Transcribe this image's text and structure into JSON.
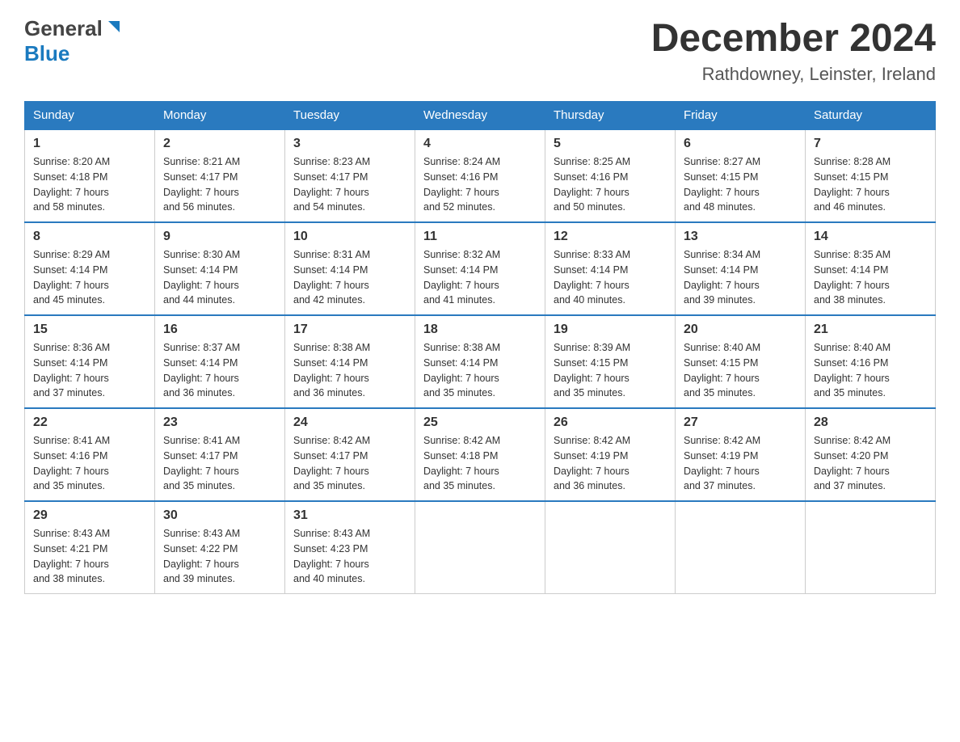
{
  "header": {
    "logo_general": "General",
    "logo_blue": "Blue",
    "title": "December 2024",
    "location": "Rathdowney, Leinster, Ireland"
  },
  "calendar": {
    "days_of_week": [
      "Sunday",
      "Monday",
      "Tuesday",
      "Wednesday",
      "Thursday",
      "Friday",
      "Saturday"
    ],
    "weeks": [
      [
        {
          "day": "1",
          "sunrise": "Sunrise: 8:20 AM",
          "sunset": "Sunset: 4:18 PM",
          "daylight": "Daylight: 7 hours",
          "minutes": "and 58 minutes."
        },
        {
          "day": "2",
          "sunrise": "Sunrise: 8:21 AM",
          "sunset": "Sunset: 4:17 PM",
          "daylight": "Daylight: 7 hours",
          "minutes": "and 56 minutes."
        },
        {
          "day": "3",
          "sunrise": "Sunrise: 8:23 AM",
          "sunset": "Sunset: 4:17 PM",
          "daylight": "Daylight: 7 hours",
          "minutes": "and 54 minutes."
        },
        {
          "day": "4",
          "sunrise": "Sunrise: 8:24 AM",
          "sunset": "Sunset: 4:16 PM",
          "daylight": "Daylight: 7 hours",
          "minutes": "and 52 minutes."
        },
        {
          "day": "5",
          "sunrise": "Sunrise: 8:25 AM",
          "sunset": "Sunset: 4:16 PM",
          "daylight": "Daylight: 7 hours",
          "minutes": "and 50 minutes."
        },
        {
          "day": "6",
          "sunrise": "Sunrise: 8:27 AM",
          "sunset": "Sunset: 4:15 PM",
          "daylight": "Daylight: 7 hours",
          "minutes": "and 48 minutes."
        },
        {
          "day": "7",
          "sunrise": "Sunrise: 8:28 AM",
          "sunset": "Sunset: 4:15 PM",
          "daylight": "Daylight: 7 hours",
          "minutes": "and 46 minutes."
        }
      ],
      [
        {
          "day": "8",
          "sunrise": "Sunrise: 8:29 AM",
          "sunset": "Sunset: 4:14 PM",
          "daylight": "Daylight: 7 hours",
          "minutes": "and 45 minutes."
        },
        {
          "day": "9",
          "sunrise": "Sunrise: 8:30 AM",
          "sunset": "Sunset: 4:14 PM",
          "daylight": "Daylight: 7 hours",
          "minutes": "and 44 minutes."
        },
        {
          "day": "10",
          "sunrise": "Sunrise: 8:31 AM",
          "sunset": "Sunset: 4:14 PM",
          "daylight": "Daylight: 7 hours",
          "minutes": "and 42 minutes."
        },
        {
          "day": "11",
          "sunrise": "Sunrise: 8:32 AM",
          "sunset": "Sunset: 4:14 PM",
          "daylight": "Daylight: 7 hours",
          "minutes": "and 41 minutes."
        },
        {
          "day": "12",
          "sunrise": "Sunrise: 8:33 AM",
          "sunset": "Sunset: 4:14 PM",
          "daylight": "Daylight: 7 hours",
          "minutes": "and 40 minutes."
        },
        {
          "day": "13",
          "sunrise": "Sunrise: 8:34 AM",
          "sunset": "Sunset: 4:14 PM",
          "daylight": "Daylight: 7 hours",
          "minutes": "and 39 minutes."
        },
        {
          "day": "14",
          "sunrise": "Sunrise: 8:35 AM",
          "sunset": "Sunset: 4:14 PM",
          "daylight": "Daylight: 7 hours",
          "minutes": "and 38 minutes."
        }
      ],
      [
        {
          "day": "15",
          "sunrise": "Sunrise: 8:36 AM",
          "sunset": "Sunset: 4:14 PM",
          "daylight": "Daylight: 7 hours",
          "minutes": "and 37 minutes."
        },
        {
          "day": "16",
          "sunrise": "Sunrise: 8:37 AM",
          "sunset": "Sunset: 4:14 PM",
          "daylight": "Daylight: 7 hours",
          "minutes": "and 36 minutes."
        },
        {
          "day": "17",
          "sunrise": "Sunrise: 8:38 AM",
          "sunset": "Sunset: 4:14 PM",
          "daylight": "Daylight: 7 hours",
          "minutes": "and 36 minutes."
        },
        {
          "day": "18",
          "sunrise": "Sunrise: 8:38 AM",
          "sunset": "Sunset: 4:14 PM",
          "daylight": "Daylight: 7 hours",
          "minutes": "and 35 minutes."
        },
        {
          "day": "19",
          "sunrise": "Sunrise: 8:39 AM",
          "sunset": "Sunset: 4:15 PM",
          "daylight": "Daylight: 7 hours",
          "minutes": "and 35 minutes."
        },
        {
          "day": "20",
          "sunrise": "Sunrise: 8:40 AM",
          "sunset": "Sunset: 4:15 PM",
          "daylight": "Daylight: 7 hours",
          "minutes": "and 35 minutes."
        },
        {
          "day": "21",
          "sunrise": "Sunrise: 8:40 AM",
          "sunset": "Sunset: 4:16 PM",
          "daylight": "Daylight: 7 hours",
          "minutes": "and 35 minutes."
        }
      ],
      [
        {
          "day": "22",
          "sunrise": "Sunrise: 8:41 AM",
          "sunset": "Sunset: 4:16 PM",
          "daylight": "Daylight: 7 hours",
          "minutes": "and 35 minutes."
        },
        {
          "day": "23",
          "sunrise": "Sunrise: 8:41 AM",
          "sunset": "Sunset: 4:17 PM",
          "daylight": "Daylight: 7 hours",
          "minutes": "and 35 minutes."
        },
        {
          "day": "24",
          "sunrise": "Sunrise: 8:42 AM",
          "sunset": "Sunset: 4:17 PM",
          "daylight": "Daylight: 7 hours",
          "minutes": "and 35 minutes."
        },
        {
          "day": "25",
          "sunrise": "Sunrise: 8:42 AM",
          "sunset": "Sunset: 4:18 PM",
          "daylight": "Daylight: 7 hours",
          "minutes": "and 35 minutes."
        },
        {
          "day": "26",
          "sunrise": "Sunrise: 8:42 AM",
          "sunset": "Sunset: 4:19 PM",
          "daylight": "Daylight: 7 hours",
          "minutes": "and 36 minutes."
        },
        {
          "day": "27",
          "sunrise": "Sunrise: 8:42 AM",
          "sunset": "Sunset: 4:19 PM",
          "daylight": "Daylight: 7 hours",
          "minutes": "and 37 minutes."
        },
        {
          "day": "28",
          "sunrise": "Sunrise: 8:42 AM",
          "sunset": "Sunset: 4:20 PM",
          "daylight": "Daylight: 7 hours",
          "minutes": "and 37 minutes."
        }
      ],
      [
        {
          "day": "29",
          "sunrise": "Sunrise: 8:43 AM",
          "sunset": "Sunset: 4:21 PM",
          "daylight": "Daylight: 7 hours",
          "minutes": "and 38 minutes."
        },
        {
          "day": "30",
          "sunrise": "Sunrise: 8:43 AM",
          "sunset": "Sunset: 4:22 PM",
          "daylight": "Daylight: 7 hours",
          "minutes": "and 39 minutes."
        },
        {
          "day": "31",
          "sunrise": "Sunrise: 8:43 AM",
          "sunset": "Sunset: 4:23 PM",
          "daylight": "Daylight: 7 hours",
          "minutes": "and 40 minutes."
        },
        null,
        null,
        null,
        null
      ]
    ]
  }
}
